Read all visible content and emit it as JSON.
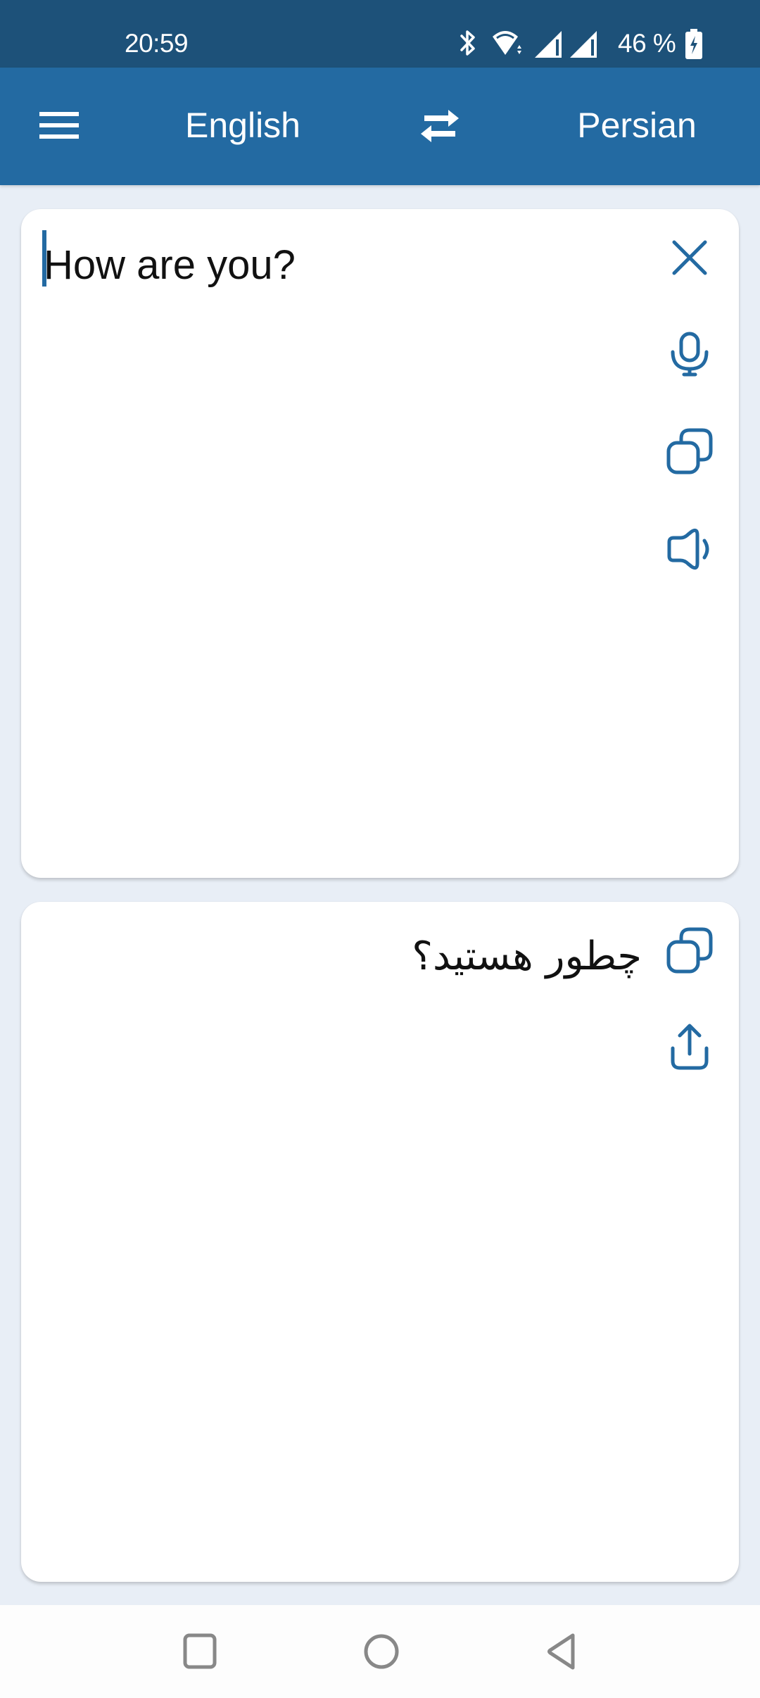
{
  "status_bar": {
    "time": "20:59",
    "battery_percent": "46 %",
    "icons": [
      "bluetooth-icon",
      "wifi-icon",
      "signal-icon",
      "signal-icon",
      "battery-charging-icon"
    ]
  },
  "app_bar": {
    "menu_icon": "hamburger-menu-icon",
    "source_language": "English",
    "swap_icon": "swap-arrows-icon",
    "target_language": "Persian"
  },
  "input_card": {
    "text": "How are you?",
    "actions": [
      {
        "icon": "close-icon",
        "label": "Clear"
      },
      {
        "icon": "microphone-icon",
        "label": "Voice input"
      },
      {
        "icon": "copy-icon",
        "label": "Copy"
      },
      {
        "icon": "speaker-icon",
        "label": "Speak"
      }
    ]
  },
  "output_card": {
    "text": "چطور هستید؟",
    "actions": [
      {
        "icon": "copy-icon",
        "label": "Copy"
      },
      {
        "icon": "share-icon",
        "label": "Share"
      }
    ]
  },
  "nav_bar": {
    "buttons": [
      {
        "icon": "recents-square-icon",
        "label": "Recents"
      },
      {
        "icon": "home-circle-icon",
        "label": "Home"
      },
      {
        "icon": "back-triangle-icon",
        "label": "Back"
      }
    ]
  },
  "colors": {
    "status_bar": "#1d5179",
    "app_bar": "#236aa2",
    "accent": "#236aa2",
    "background": "#e8eef6",
    "card": "#ffffff"
  }
}
